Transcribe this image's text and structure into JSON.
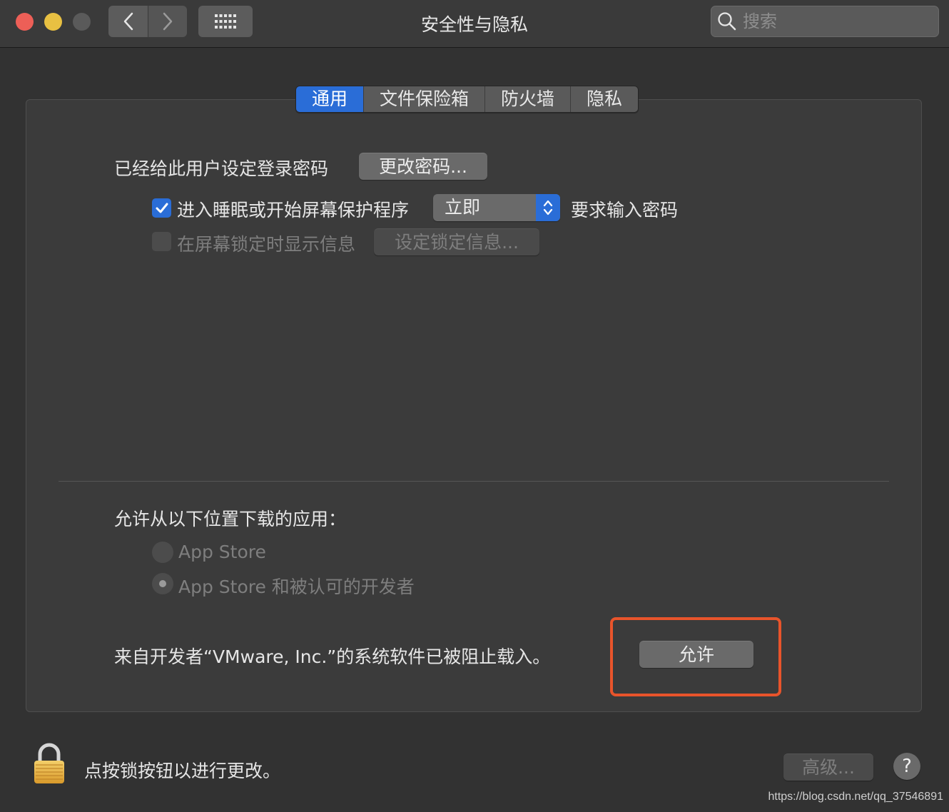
{
  "window": {
    "title": "安全性与隐私",
    "search_placeholder": "搜索"
  },
  "tabs": [
    {
      "label": "通用",
      "active": true
    },
    {
      "label": "文件保险箱",
      "active": false
    },
    {
      "label": "防火墙",
      "active": false
    },
    {
      "label": "隐私",
      "active": false
    }
  ],
  "general": {
    "password_set_label": "已经给此用户设定登录密码",
    "change_password_button": "更改密码...",
    "require_password": {
      "checked": true,
      "prefix": "进入睡眠或开始屏幕保护程序",
      "delay_value": "立即",
      "suffix": "要求输入密码"
    },
    "lock_message": {
      "checked": false,
      "label": "在屏幕锁定时显示信息",
      "button": "设定锁定信息..."
    }
  },
  "downloads": {
    "heading": "允许从以下位置下载的应用：",
    "options": [
      {
        "label": "App Store",
        "selected": false
      },
      {
        "label": "App Store 和被认可的开发者",
        "selected": true
      }
    ]
  },
  "blocked": {
    "message": "来自开发者“VMware, Inc.”的系统软件已被阻止载入。",
    "allow_button": "允许"
  },
  "footer": {
    "lock_text": "点按锁按钮以进行更改。",
    "advanced_button": "高级...",
    "help_button": "?"
  },
  "watermark": "https://blog.csdn.net/qq_37546891",
  "colors": {
    "accent": "#2a6dd7",
    "highlight_box": "#e8542b"
  }
}
